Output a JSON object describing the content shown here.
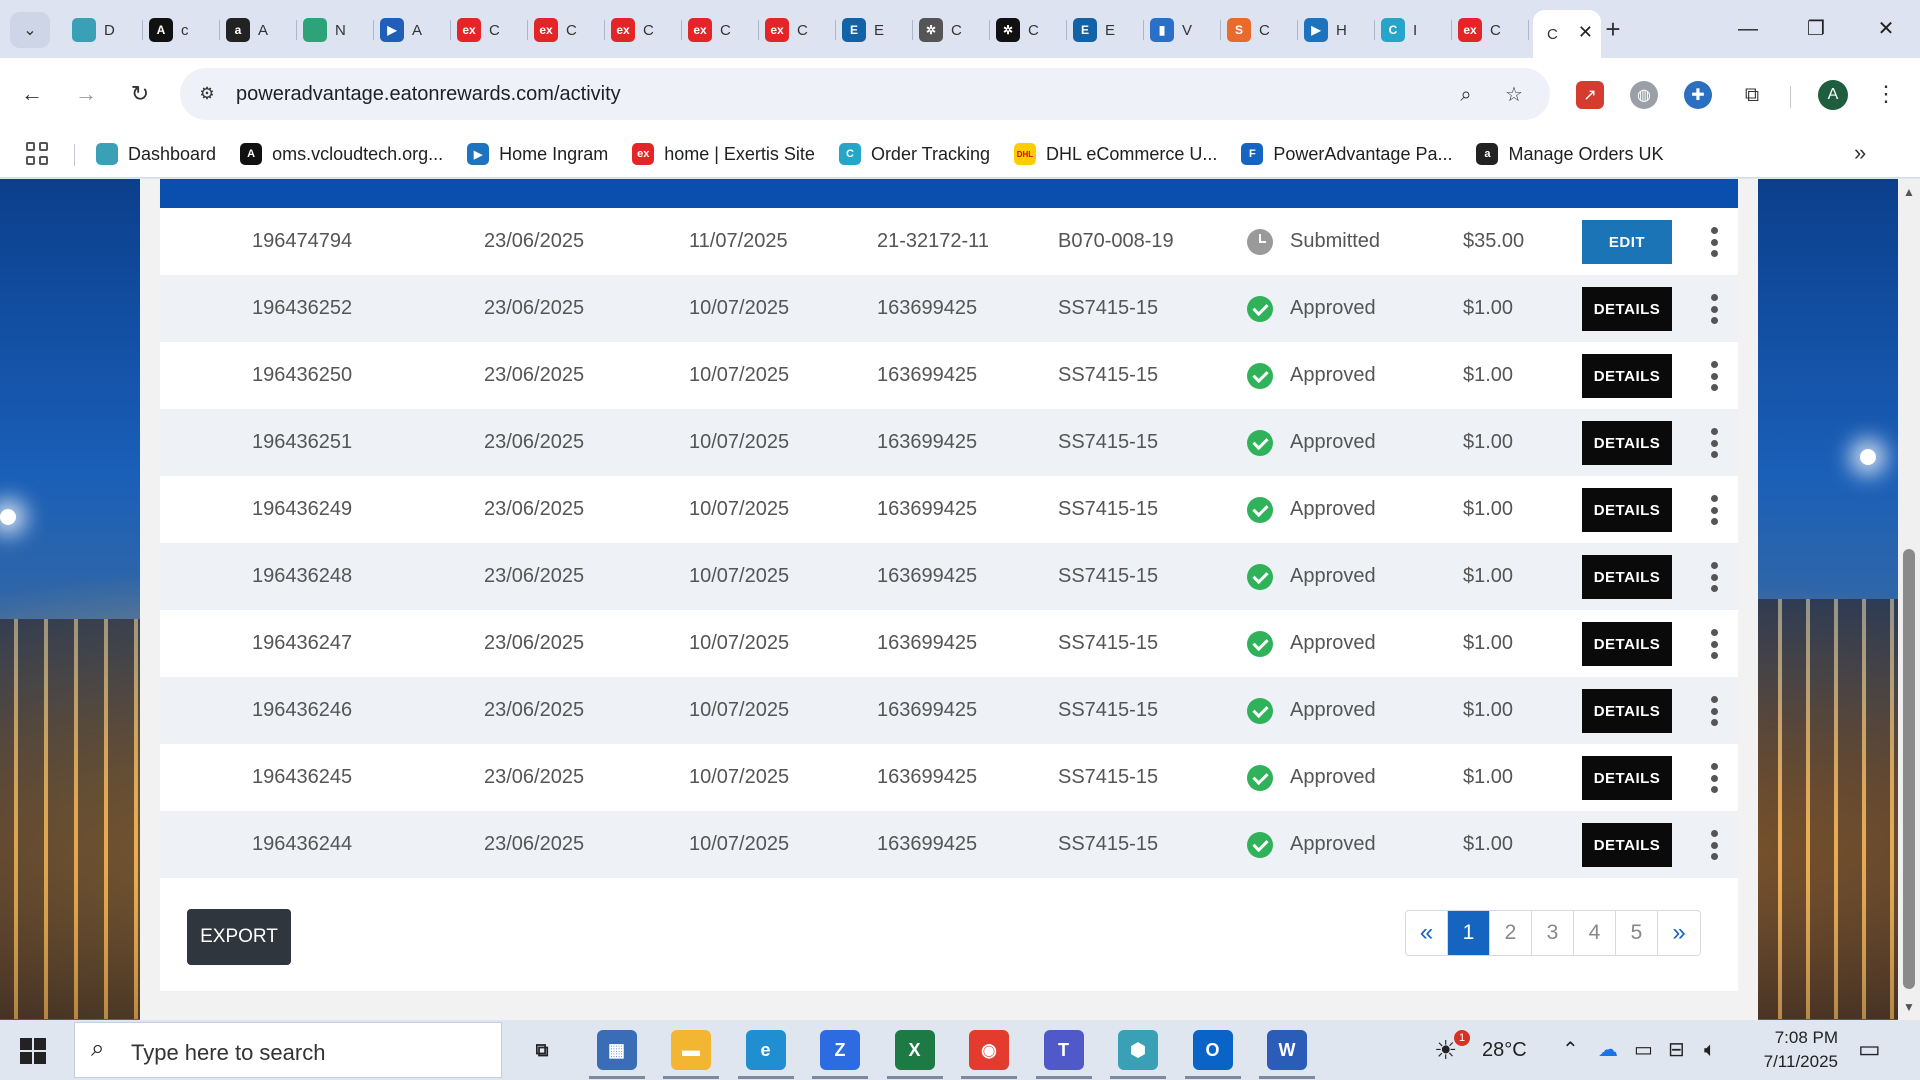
{
  "browser": {
    "tabs": [
      {
        "icon": "hexagon-icon",
        "color": "#3aa0b5",
        "glyph": "",
        "title": "D"
      },
      {
        "icon": "a-circle-icon",
        "color": "#111111",
        "glyph": "A",
        "title": "c"
      },
      {
        "icon": "amazon-icon",
        "color": "#222222",
        "glyph": "a",
        "title": "A"
      },
      {
        "icon": "leaf-icon",
        "color": "#2ea37a",
        "glyph": "",
        "title": "N"
      },
      {
        "icon": "play-arrow-icon",
        "color": "#1f5fb8",
        "glyph": "▶",
        "title": "A"
      },
      {
        "icon": "exertis-icon",
        "color": "#e42528",
        "glyph": "ex",
        "title": "C"
      },
      {
        "icon": "exertis-icon",
        "color": "#e42528",
        "glyph": "ex",
        "title": "C"
      },
      {
        "icon": "exertis-icon",
        "color": "#e42528",
        "glyph": "ex",
        "title": "C"
      },
      {
        "icon": "exertis-icon",
        "color": "#e42528",
        "glyph": "ex",
        "title": "C"
      },
      {
        "icon": "exertis-icon",
        "color": "#e42528",
        "glyph": "ex",
        "title": "C"
      },
      {
        "icon": "e-logo-icon",
        "color": "#1262a8",
        "glyph": "E",
        "title": "E"
      },
      {
        "icon": "openai-icon",
        "color": "#555555",
        "glyph": "✲",
        "title": "C"
      },
      {
        "icon": "openai-icon",
        "color": "#111111",
        "glyph": "✲",
        "title": "C"
      },
      {
        "icon": "e-logo-icon",
        "color": "#1262a8",
        "glyph": "E",
        "title": "E"
      },
      {
        "icon": "bar-chart-icon",
        "color": "#2a70c8",
        "glyph": "▮",
        "title": "V"
      },
      {
        "icon": "s-logo-icon",
        "color": "#e86a2c",
        "glyph": "S",
        "title": "C"
      },
      {
        "icon": "ingram-icon",
        "color": "#1e73be",
        "glyph": "▶",
        "title": "H"
      },
      {
        "icon": "c-logo-icon",
        "color": "#25a6c9",
        "glyph": "C",
        "title": "I"
      },
      {
        "icon": "exertis-icon",
        "color": "#e42528",
        "glyph": "ex",
        "title": "C"
      }
    ],
    "active_tab_title": "C",
    "url": "poweradvantage.eatonrewards.com/activity",
    "bookmarks": [
      {
        "label": "Dashboard",
        "icon": "hexagon-icon",
        "color": "#3aa0b5",
        "glyph": ""
      },
      {
        "label": "oms.vcloudtech.org...",
        "icon": "a-circle-icon",
        "color": "#111111",
        "glyph": "A"
      },
      {
        "label": "Home Ingram",
        "icon": "ingram-icon",
        "color": "#1e73be",
        "glyph": "▶"
      },
      {
        "label": "home | Exertis Site",
        "icon": "exertis-icon",
        "color": "#e42528",
        "glyph": "ex"
      },
      {
        "label": "Order Tracking",
        "icon": "c-logo-icon",
        "color": "#25a6c9",
        "glyph": "C"
      },
      {
        "label": "DHL eCommerce U...",
        "icon": "dhl-icon",
        "color": "#ffcc00",
        "glyph": "DHL"
      },
      {
        "label": "PowerAdvantage Pa...",
        "icon": "flag-icon",
        "color": "#1565c0",
        "glyph": "F"
      },
      {
        "label": "Manage Orders UK",
        "icon": "amazon-icon",
        "color": "#222222",
        "glyph": "a"
      }
    ]
  },
  "table": {
    "rows": [
      {
        "id": "196474794",
        "date1": "23/06/2025",
        "date2": "11/07/2025",
        "invoice": "21-32172-11",
        "part": "B070-008-19",
        "status": "Submitted",
        "status_type": "pending",
        "amount": "$35.00",
        "action": "EDIT"
      },
      {
        "id": "196436252",
        "date1": "23/06/2025",
        "date2": "10/07/2025",
        "invoice": "163699425",
        "part": "SS7415-15",
        "status": "Approved",
        "status_type": "ok",
        "amount": "$1.00",
        "action": "DETAILS"
      },
      {
        "id": "196436250",
        "date1": "23/06/2025",
        "date2": "10/07/2025",
        "invoice": "163699425",
        "part": "SS7415-15",
        "status": "Approved",
        "status_type": "ok",
        "amount": "$1.00",
        "action": "DETAILS"
      },
      {
        "id": "196436251",
        "date1": "23/06/2025",
        "date2": "10/07/2025",
        "invoice": "163699425",
        "part": "SS7415-15",
        "status": "Approved",
        "status_type": "ok",
        "amount": "$1.00",
        "action": "DETAILS"
      },
      {
        "id": "196436249",
        "date1": "23/06/2025",
        "date2": "10/07/2025",
        "invoice": "163699425",
        "part": "SS7415-15",
        "status": "Approved",
        "status_type": "ok",
        "amount": "$1.00",
        "action": "DETAILS"
      },
      {
        "id": "196436248",
        "date1": "23/06/2025",
        "date2": "10/07/2025",
        "invoice": "163699425",
        "part": "SS7415-15",
        "status": "Approved",
        "status_type": "ok",
        "amount": "$1.00",
        "action": "DETAILS"
      },
      {
        "id": "196436247",
        "date1": "23/06/2025",
        "date2": "10/07/2025",
        "invoice": "163699425",
        "part": "SS7415-15",
        "status": "Approved",
        "status_type": "ok",
        "amount": "$1.00",
        "action": "DETAILS"
      },
      {
        "id": "196436246",
        "date1": "23/06/2025",
        "date2": "10/07/2025",
        "invoice": "163699425",
        "part": "SS7415-15",
        "status": "Approved",
        "status_type": "ok",
        "amount": "$1.00",
        "action": "DETAILS"
      },
      {
        "id": "196436245",
        "date1": "23/06/2025",
        "date2": "10/07/2025",
        "invoice": "163699425",
        "part": "SS7415-15",
        "status": "Approved",
        "status_type": "ok",
        "amount": "$1.00",
        "action": "DETAILS"
      },
      {
        "id": "196436244",
        "date1": "23/06/2025",
        "date2": "10/07/2025",
        "invoice": "163699425",
        "part": "SS7415-15",
        "status": "Approved",
        "status_type": "ok",
        "amount": "$1.00",
        "action": "DETAILS"
      }
    ]
  },
  "footer": {
    "export_label": "EXPORT",
    "pagination": {
      "prev": "«",
      "next": "»",
      "pages": [
        "1",
        "2",
        "3",
        "4",
        "5"
      ],
      "current": "1"
    }
  },
  "colors": {
    "header_bar": "#0a4fae",
    "edit_button": "#1a74b6",
    "details_button": "#0a0a0a",
    "approved": "#2fb25a",
    "pending": "#9a9a9a",
    "page_active": "#1565c0"
  },
  "taskbar": {
    "search_placeholder": "Type here to search",
    "weather_temp": "28°C",
    "weather_badge": "1",
    "time": "7:08 PM",
    "date": "7/11/2025",
    "apps": [
      {
        "name": "task-view-icon",
        "color": "#dfe6f0",
        "glyph": "⧉"
      },
      {
        "name": "calculator-icon",
        "color": "#3a6db5",
        "glyph": "▦"
      },
      {
        "name": "file-explorer-icon",
        "color": "#f2b632",
        "glyph": "▬"
      },
      {
        "name": "edge-icon",
        "color": "#1f8fd1",
        "glyph": "e"
      },
      {
        "name": "zoom-icon",
        "color": "#2d6ce0",
        "glyph": "Z"
      },
      {
        "name": "excel-icon",
        "color": "#1e7a45",
        "glyph": "X"
      },
      {
        "name": "chrome-icon",
        "color": "#e33b2e",
        "glyph": "◉"
      },
      {
        "name": "teams-icon",
        "color": "#5059c9",
        "glyph": "T"
      },
      {
        "name": "hexagon-app-icon",
        "color": "#3aa0b5",
        "glyph": "⬢"
      },
      {
        "name": "outlook-icon",
        "color": "#0a64c8",
        "glyph": "O"
      },
      {
        "name": "word-icon",
        "color": "#2b5cb8",
        "glyph": "W"
      }
    ]
  }
}
